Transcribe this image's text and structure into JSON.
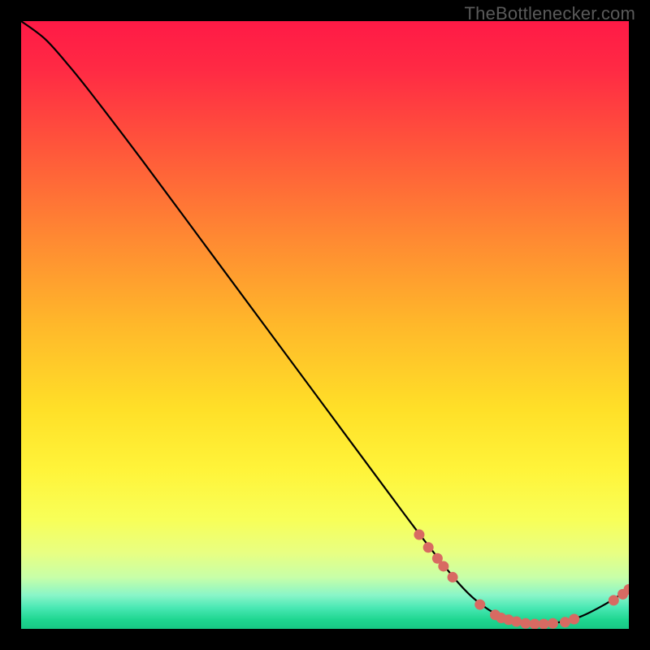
{
  "watermark": "TheBottleneсker.com",
  "chart_data": {
    "type": "line",
    "title": "",
    "xlabel": "",
    "ylabel": "",
    "xlim": [
      0,
      100
    ],
    "ylim": [
      0,
      100
    ],
    "grid": false,
    "background_gradient_stops": [
      {
        "offset": 0.0,
        "color": "#ff1a46"
      },
      {
        "offset": 0.08,
        "color": "#ff2a44"
      },
      {
        "offset": 0.22,
        "color": "#ff5a3a"
      },
      {
        "offset": 0.36,
        "color": "#ff8a32"
      },
      {
        "offset": 0.5,
        "color": "#ffb82a"
      },
      {
        "offset": 0.64,
        "color": "#ffe028"
      },
      {
        "offset": 0.74,
        "color": "#fff43a"
      },
      {
        "offset": 0.82,
        "color": "#f8ff58"
      },
      {
        "offset": 0.875,
        "color": "#e8ff82"
      },
      {
        "offset": 0.915,
        "color": "#c8ffa8"
      },
      {
        "offset": 0.945,
        "color": "#88f5c8"
      },
      {
        "offset": 0.965,
        "color": "#4ae8b4"
      },
      {
        "offset": 0.985,
        "color": "#1ed690"
      },
      {
        "offset": 1.0,
        "color": "#18c884"
      }
    ],
    "series": [
      {
        "name": "bottleneck-curve",
        "stroke": "#000000",
        "points": [
          {
            "x": 0.0,
            "y": 100.0
          },
          {
            "x": 4.0,
            "y": 97.0
          },
          {
            "x": 8.0,
            "y": 92.5
          },
          {
            "x": 12.0,
            "y": 87.5
          },
          {
            "x": 20.0,
            "y": 77.0
          },
          {
            "x": 30.0,
            "y": 63.5
          },
          {
            "x": 40.0,
            "y": 50.0
          },
          {
            "x": 50.0,
            "y": 36.5
          },
          {
            "x": 60.0,
            "y": 23.0
          },
          {
            "x": 66.0,
            "y": 15.0
          },
          {
            "x": 72.0,
            "y": 7.5
          },
          {
            "x": 76.0,
            "y": 3.8
          },
          {
            "x": 80.0,
            "y": 1.6
          },
          {
            "x": 84.0,
            "y": 0.8
          },
          {
            "x": 88.0,
            "y": 1.0
          },
          {
            "x": 92.0,
            "y": 2.0
          },
          {
            "x": 96.0,
            "y": 4.0
          },
          {
            "x": 100.0,
            "y": 6.5
          }
        ]
      }
    ],
    "markers": {
      "color": "#d86a62",
      "radius": 6.5,
      "points": [
        {
          "x": 65.5,
          "y": 15.5
        },
        {
          "x": 67.0,
          "y": 13.4
        },
        {
          "x": 68.5,
          "y": 11.6
        },
        {
          "x": 69.5,
          "y": 10.3
        },
        {
          "x": 71.0,
          "y": 8.5
        },
        {
          "x": 75.5,
          "y": 4.0
        },
        {
          "x": 78.0,
          "y": 2.3
        },
        {
          "x": 79.0,
          "y": 1.8
        },
        {
          "x": 80.2,
          "y": 1.5
        },
        {
          "x": 81.5,
          "y": 1.2
        },
        {
          "x": 83.0,
          "y": 0.9
        },
        {
          "x": 84.5,
          "y": 0.8
        },
        {
          "x": 86.0,
          "y": 0.8
        },
        {
          "x": 87.5,
          "y": 0.9
        },
        {
          "x": 89.5,
          "y": 1.1
        },
        {
          "x": 91.0,
          "y": 1.6
        },
        {
          "x": 97.5,
          "y": 4.7
        },
        {
          "x": 99.0,
          "y": 5.7
        },
        {
          "x": 100.0,
          "y": 6.5
        }
      ]
    }
  }
}
